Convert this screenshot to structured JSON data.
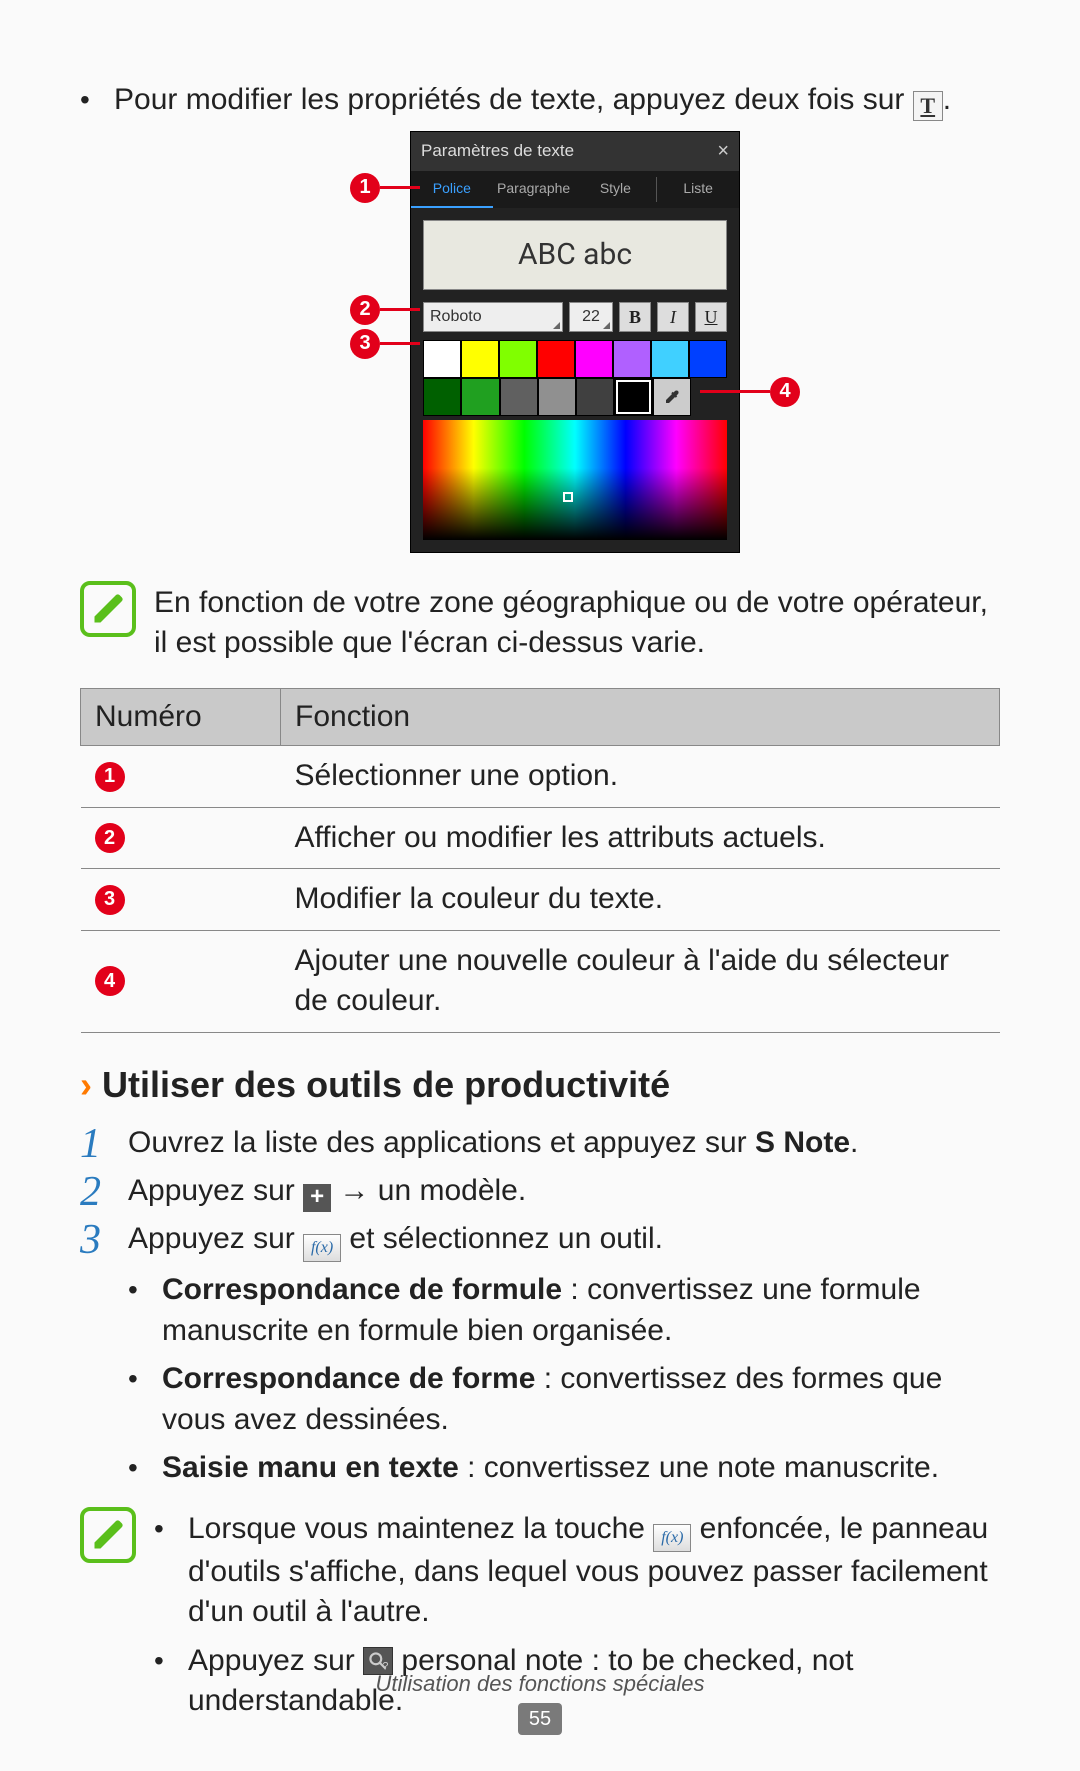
{
  "intro": {
    "text_before": "Pour modifier les propriétés de texte, appuyez deux fois sur ",
    "text_after": ".",
    "icon_glyph": "T"
  },
  "text_settings": {
    "title": "Paramètres de texte",
    "tabs": [
      "Police",
      "Paragraphe",
      "Style",
      "Liste"
    ],
    "active_tab_index": 0,
    "preview": "ABC abc",
    "font_name": "Roboto",
    "font_size": "22",
    "btn_bold": "B",
    "btn_italic": "I",
    "btn_underline": "U",
    "swatch_rows": [
      [
        "#ffffff",
        "#ffff00",
        "#80ff00",
        "#ff0000",
        "#ff00ff",
        "#b060ff",
        "#40d0ff",
        "#0040ff"
      ],
      [
        "#006000",
        "#20a020",
        "#606060",
        "#909090",
        "#404040",
        "#000000",
        "eyedropper",
        ""
      ]
    ]
  },
  "callouts": {
    "c1": "1",
    "c2": "2",
    "c3": "3",
    "c4": "4"
  },
  "note1": "En fonction de votre zone géographique ou de votre opérateur, il est possible que l'écran ci-dessus varie.",
  "table": {
    "head_num": "Numéro",
    "head_func": "Fonction",
    "rows": [
      {
        "n": "1",
        "f": "Sélectionner une option."
      },
      {
        "n": "2",
        "f": "Afficher ou modifier les attributs actuels."
      },
      {
        "n": "3",
        "f": "Modifier la couleur du texte."
      },
      {
        "n": "4",
        "f": "Ajouter une nouvelle couleur à l'aide du sélecteur de couleur."
      }
    ]
  },
  "section_title": "Utiliser des outils de productivité",
  "steps": {
    "s1_num": "1",
    "s1_a": "Ouvrez la liste des applications et appuyez sur ",
    "s1_bold": "S Note",
    "s1_b": ".",
    "s2_num": "2",
    "s2_a": "Appuyez sur ",
    "s2_b": " → un modèle.",
    "s3_num": "3",
    "s3_a": "Appuyez sur ",
    "s3_b": " et sélectionnez un outil."
  },
  "tools": {
    "t1_bold": "Correspondance de formule",
    "t1_rest": " : convertissez une formule manuscrite en formule bien organisée.",
    "t2_bold": "Correspondance de forme",
    "t2_rest": " : convertissez des formes que vous avez dessinées.",
    "t3_bold": "Saisie manu en texte",
    "t3_rest": " : convertissez une note manuscrite."
  },
  "note2": {
    "b1_a": "Lorsque vous maintenez la touche ",
    "b1_b": " enfoncée, le panneau d'outils s'affiche, dans lequel vous pouvez passer facilement d'un outil à l'autre.",
    "b2_a": "Appuyez sur ",
    "b2_b": " personal note : to be checked, not understandable."
  },
  "footer": {
    "caption": "Utilisation des fonctions spéciales",
    "page": "55"
  },
  "glyphs": {
    "fx": "f(x)",
    "plus": "+"
  }
}
